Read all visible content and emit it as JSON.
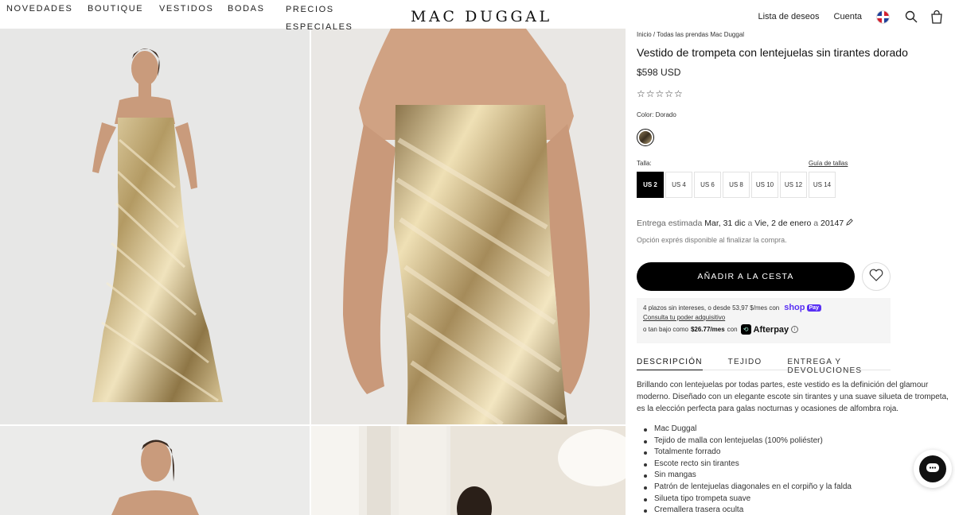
{
  "nav": {
    "items": [
      "NOVEDADES",
      "BOUTIQUE",
      "VESTIDOS",
      "BODAS",
      "PRECIOS ESPECIALES"
    ]
  },
  "brand": {
    "logo": "MAC DUGGAL"
  },
  "header": {
    "wishlist": "Lista de deseos",
    "account": "Cuenta",
    "icons": [
      "flag-icon",
      "search-icon",
      "cart-icon"
    ]
  },
  "product": {
    "breadcrumb": "Inicio / Todas las prendas Mac Duggal",
    "title": "Vestido de trompeta con lentejuelas sin tirantes dorado",
    "price": "$598 USD",
    "rating_stars": "☆☆☆☆☆",
    "color_label": "Color: Dorado",
    "size_label": "Talla:",
    "size_guide": "Guía de tallas",
    "sizes": [
      "US 2",
      "US 4",
      "US 6",
      "US 8",
      "US 10",
      "US 12",
      "US 14"
    ],
    "selected_size": "US 2",
    "delivery": {
      "prefix": "Entrega estimada",
      "from": "Mar, 31 dic",
      "a1": "a",
      "to": "Vie, 2 de enero",
      "a2": "a",
      "zip": "20147"
    },
    "express": "Opción exprés disponible al finalizar la compra.",
    "add_to_cart": "AÑADIR A LA CESTA",
    "payment": {
      "shop_text": "4 plazos sin intereses, o desde 53,97 $/mes con",
      "shop_brand": "shop",
      "shop_pay": "Pay",
      "check_link": "Consulta tu poder adquisitivo",
      "afterpay_prefix": "o tan bajo como",
      "afterpay_amount": "$26.77/mes",
      "afterpay_con": "con",
      "afterpay_brand": "Afterpay"
    },
    "tabs": [
      "DESCRIPCIÓN",
      "TEJIDO",
      "ENTREGA Y DEVOLUCIONES"
    ],
    "active_tab": "DESCRIPCIÓN",
    "description": "Brillando con lentejuelas por todas partes, este vestido es la definición del glamour moderno. Diseñado con un elegante escote sin tirantes y una suave silueta de trompeta, es la elección perfecta para galas nocturnas y ocasiones de alfombra roja.",
    "features": [
      "Mac Duggal",
      "Tejido de malla con lentejuelas (100% poliéster)",
      "Totalmente forrado",
      "Escote recto sin tirantes",
      "Sin mangas",
      "Patrón de lentejuelas diagonales en el corpiño y la falda",
      "Silueta tipo trompeta suave",
      "Cremallera trasera oculta"
    ]
  },
  "colors": {
    "primary_button": "#000000",
    "shop_pay": "#5a31f4",
    "gold": "#c9b27d"
  }
}
